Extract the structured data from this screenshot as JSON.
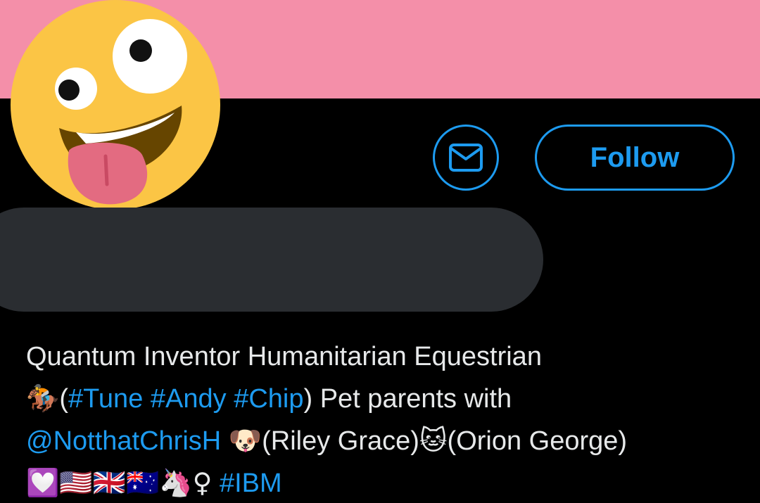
{
  "profile": {
    "banner_color": "#f48fa9",
    "avatar_icon": "zany-face-icon",
    "follow_label": "Follow",
    "message_icon": "envelope-icon",
    "accent_color": "#1d9bf0"
  },
  "bio": {
    "line1": "Quantum Inventor Humanitarian Equestrian",
    "jockey_emoji": "🏇",
    "paren_open": "(",
    "tag_tune": "#Tune",
    "tag_andy": "#Andy",
    "tag_chip": "#Chip",
    "line2_rest": ") Pet parents with",
    "mention": "@NotthatChrisH",
    "dog_emoji": "🐶",
    "riley": "(Riley Grace)",
    "cat_emoji": "🐱",
    "orion": "(Orion George)",
    "line4_emojis": "💟🇺🇸🇬🇧🇦🇺🦄",
    "female_sign": "♀",
    "tag_ibm": "#IBM"
  }
}
